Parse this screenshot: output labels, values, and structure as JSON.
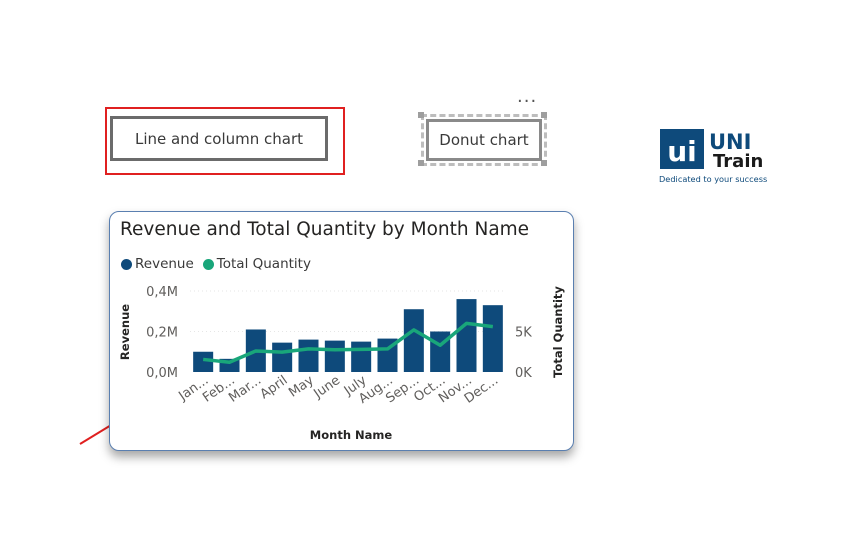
{
  "buttons": {
    "line_column_label": "Line and column chart",
    "donut_label": "Donut chart",
    "more_label": "..."
  },
  "logo": {
    "mark": "ui",
    "name_top": "UNI",
    "name_bottom": "Train",
    "tagline": "Dedicated to your success"
  },
  "chart_data": {
    "type": "bar",
    "title": "Revenue and Total Quantity by Month Name",
    "xlabel": "Month Name",
    "ylabel": "Revenue",
    "y2label": "Total Quantity",
    "categories": [
      "Jan...",
      "Feb...",
      "Mar...",
      "April",
      "May",
      "June",
      "July",
      "Aug...",
      "Sep...",
      "Oct...",
      "Nov...",
      "Dec..."
    ],
    "series": [
      {
        "name": "Revenue",
        "kind": "column",
        "axis": "left",
        "color": "#0e4a7b",
        "values": [
          0.1,
          0.065,
          0.21,
          0.145,
          0.16,
          0.155,
          0.15,
          0.165,
          0.31,
          0.2,
          0.36,
          0.33
        ]
      },
      {
        "name": "Total Quantity",
        "kind": "line",
        "axis": "right",
        "color": "#19a67a",
        "values": [
          1550,
          1200,
          2600,
          2450,
          2850,
          2750,
          2800,
          2850,
          5200,
          3300,
          6000,
          5600
        ]
      }
    ],
    "ylim": [
      0,
      0.4
    ],
    "y_ticks": [
      "0,0M",
      "0,2M",
      "0,4M"
    ],
    "y2lim": [
      0,
      10000
    ],
    "y2_ticks": [
      "0K",
      "5K"
    ],
    "legend_position": "top-left"
  },
  "colors": {
    "accent_red": "#e02020",
    "revenue": "#0e4a7b",
    "quantity": "#19a67a",
    "logo_blue": "#0e4a7b"
  }
}
